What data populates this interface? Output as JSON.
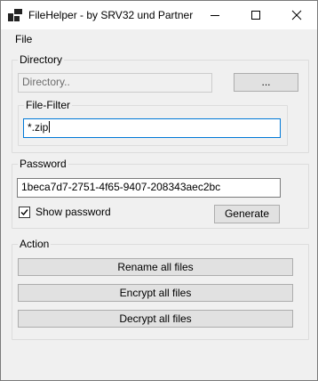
{
  "window": {
    "title": "FileHelper - by SRV32 und Partner",
    "controls": {
      "minimize_icon": "minimize-icon",
      "maximize_icon": "maximize-icon",
      "close_icon": "close-icon"
    }
  },
  "menu": {
    "file": "File"
  },
  "directory": {
    "group_label": "Directory",
    "path_placeholder": "Directory..",
    "browse_label": "...",
    "filter": {
      "group_label": "File-Filter",
      "value": "*.zip"
    }
  },
  "password": {
    "group_label": "Password",
    "value": "1beca7d7-2751-4f65-9407-208343aec2bc",
    "show_password_label": "Show password",
    "show_password_checked": true,
    "generate_label": "Generate"
  },
  "action": {
    "group_label": "Action",
    "rename_label": "Rename all files",
    "encrypt_label": "Encrypt all files",
    "decrypt_label": "Decrypt all files"
  },
  "colors": {
    "window_bg": "#f0f0f0",
    "focus_border": "#0078d7",
    "button_bg": "#e1e1e1"
  }
}
